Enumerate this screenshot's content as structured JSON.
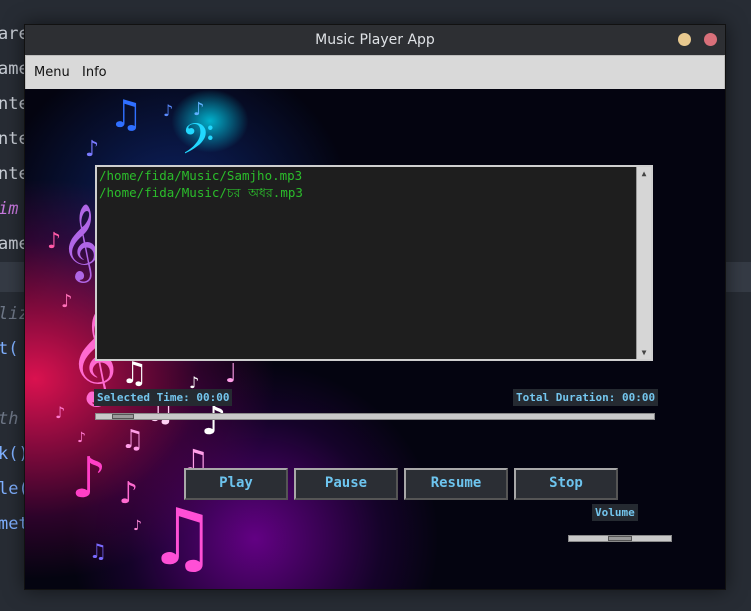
{
  "window": {
    "title": "Music Player App"
  },
  "menubar": {
    "items": [
      "Menu",
      "Info"
    ]
  },
  "playlist": {
    "items": [
      "/home/fida/Music/Samjho.mp3",
      "/home/fida/Music/চর অধর.mp3"
    ]
  },
  "labels": {
    "selected_time": "Selected Time: 00:00",
    "total_duration": "Total Duration: 00:00",
    "volume": "Volume"
  },
  "controls": {
    "play": "Play",
    "pause": "Pause",
    "resume": "Resume",
    "stop": "Stop"
  },
  "progress": {
    "value": 0.03
  },
  "volume_level": {
    "value": 0.5
  },
  "colors": {
    "accent": "#6dc4ee",
    "playlist_text": "#2bbd2b",
    "canvas_bg": "#040410"
  },
  "background_editor": {
    "fragments": [
      "are",
      "ame",
      "nte",
      "nte",
      "nte",
      "im",
      "ame",
      "liz",
      "t(",
      "th",
      "k()",
      "le(",
      "met"
    ]
  }
}
